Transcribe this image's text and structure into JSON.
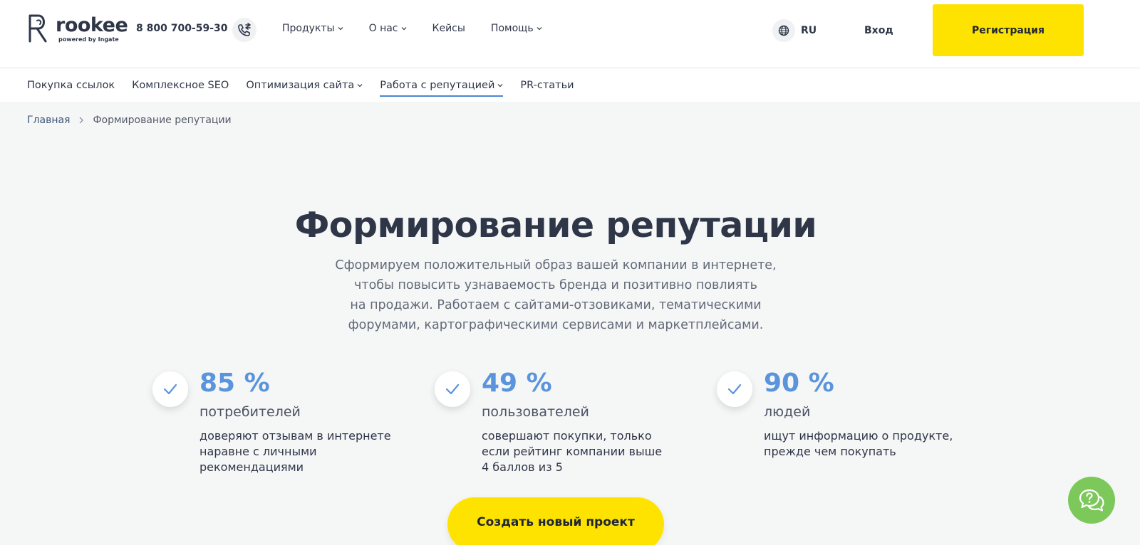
{
  "header": {
    "logo": {
      "word": "rookee",
      "sub": "powered by Ingate"
    },
    "phone": "8 800 700-59-30",
    "nav": [
      {
        "label": "Продукты",
        "has_dropdown": true
      },
      {
        "label": "О нас",
        "has_dropdown": true
      },
      {
        "label": "Кейсы",
        "has_dropdown": false
      },
      {
        "label": "Помощь",
        "has_dropdown": true
      }
    ],
    "language": "RU",
    "login_label": "Вход",
    "register_label": "Регистрация"
  },
  "subnav": [
    {
      "label": "Покупка ссылок",
      "has_dropdown": false,
      "active": false
    },
    {
      "label": "Комплексное SEO",
      "has_dropdown": false,
      "active": false
    },
    {
      "label": "Оптимизация сайта",
      "has_dropdown": true,
      "active": false
    },
    {
      "label": "Работа с репутацией",
      "has_dropdown": true,
      "active": true
    },
    {
      "label": "PR-статьи",
      "has_dropdown": false,
      "active": false
    }
  ],
  "breadcrumb": {
    "home": "Главная",
    "current": "Формирование репутации"
  },
  "hero": {
    "title": "Формирование репутации",
    "description": [
      "Сформируем положительный образ вашей компании в интернете,",
      "чтобы повысить узнаваемость бренда и позитивно повлиять",
      "на продажи. Работаем с сайтами-отзовиками, тематическими",
      "форумами, картографическими сервисами и маркетплейсами."
    ]
  },
  "stats": [
    {
      "value": "85 %",
      "unit": "потребителей",
      "text": [
        "доверяют отзывам в интернете",
        "наравне с личными",
        "рекомендациями"
      ]
    },
    {
      "value": "49 %",
      "unit": "пользователей",
      "text": [
        "совершают покупки, только",
        "если рейтинг компании выше",
        "4 баллов из 5"
      ]
    },
    {
      "value": "90 %",
      "unit": "людей",
      "text": [
        "ищут информацию о продукте,",
        "прежде чем покупать"
      ]
    }
  ],
  "cta_label": "Создать новый проект",
  "colors": {
    "accent_yellow": "#ffe300",
    "stat_blue": "#5a94dc",
    "help_green": "#7cc85a",
    "active_underline": "#4a86d3",
    "text_dark": "#2e3648"
  },
  "icons": {
    "phone_button": "phone-transfer-icon",
    "language": "globe-icon",
    "stat_marker": "check-icon",
    "breadcrumb_separator": "chevron-right-icon",
    "help": "chat-question-icon"
  }
}
